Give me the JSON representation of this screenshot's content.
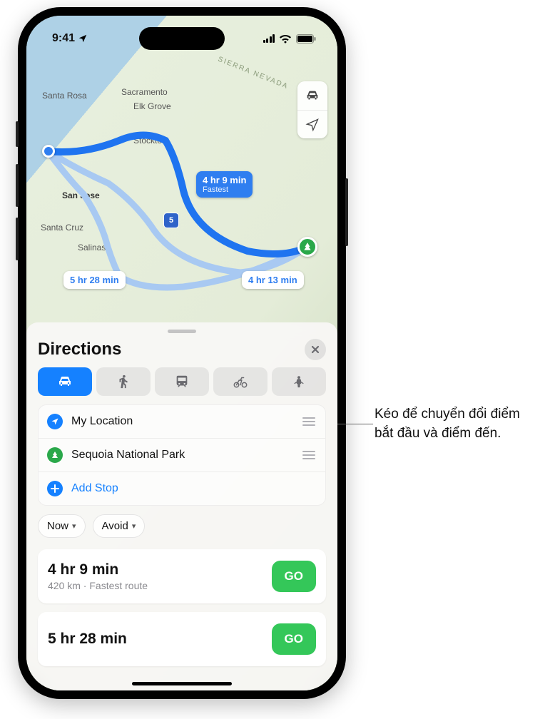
{
  "status": {
    "time": "9:41"
  },
  "sheet": {
    "title": "Directions",
    "stops": {
      "from": "My Location",
      "to": "Sequoia National Park",
      "add": "Add Stop"
    },
    "options": {
      "now": "Now",
      "avoid": "Avoid"
    },
    "routes": [
      {
        "time": "4 hr 9 min",
        "detail": "420 km · Fastest route",
        "go": "GO"
      },
      {
        "time": "5 hr 28 min",
        "detail": "",
        "go": "GO"
      }
    ]
  },
  "map": {
    "labels": {
      "santaRosa": "Santa Rosa",
      "sacramento": "Sacramento",
      "elkGrove": "Elk Grove",
      "stockton": "Stockton",
      "sanJose": "San Jose",
      "santaCruz": "Santa Cruz",
      "salinas": "Salinas",
      "sierra": "SIERRA NEVADA"
    },
    "highway": "5",
    "tags": {
      "fastest": {
        "time": "4 hr 9 min",
        "sub": "Fastest"
      },
      "alt1": "5 hr 28 min",
      "alt2": "4 hr 13 min"
    }
  },
  "callout": "Kéo để chuyển đổi điểm bắt đầu và điểm đến."
}
